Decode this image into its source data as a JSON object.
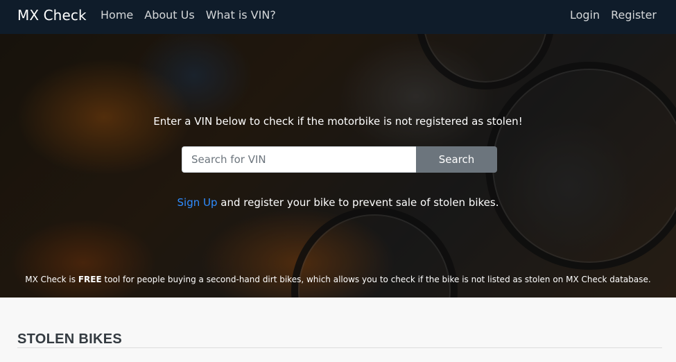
{
  "navbar": {
    "brand": "MX Check",
    "left_links": [
      "Home",
      "About Us",
      "What is VIN?"
    ],
    "right_links": [
      "Login",
      "Register"
    ]
  },
  "hero": {
    "tagline": "Enter a VIN below to check if the motorbike is not registered as stolen!",
    "search": {
      "placeholder": "Search for VIN",
      "value": "",
      "button_label": "Search"
    },
    "signup": {
      "link_text": "Sign Up",
      "rest_text": " and register your bike to prevent sale of stolen bikes."
    },
    "free_notice": {
      "prefix": "MX Check is ",
      "bold": "FREE",
      "suffix": " tool for people buying a second-hand dirt bikes, which allows you to check if the bike is not listed as stolen on MX Check database."
    }
  },
  "section": {
    "title": "STOLEN BIKES"
  },
  "colors": {
    "navbar_bg": "#0f1c2a",
    "link_accent": "#2f8cff",
    "button_bg": "#6c757d"
  }
}
